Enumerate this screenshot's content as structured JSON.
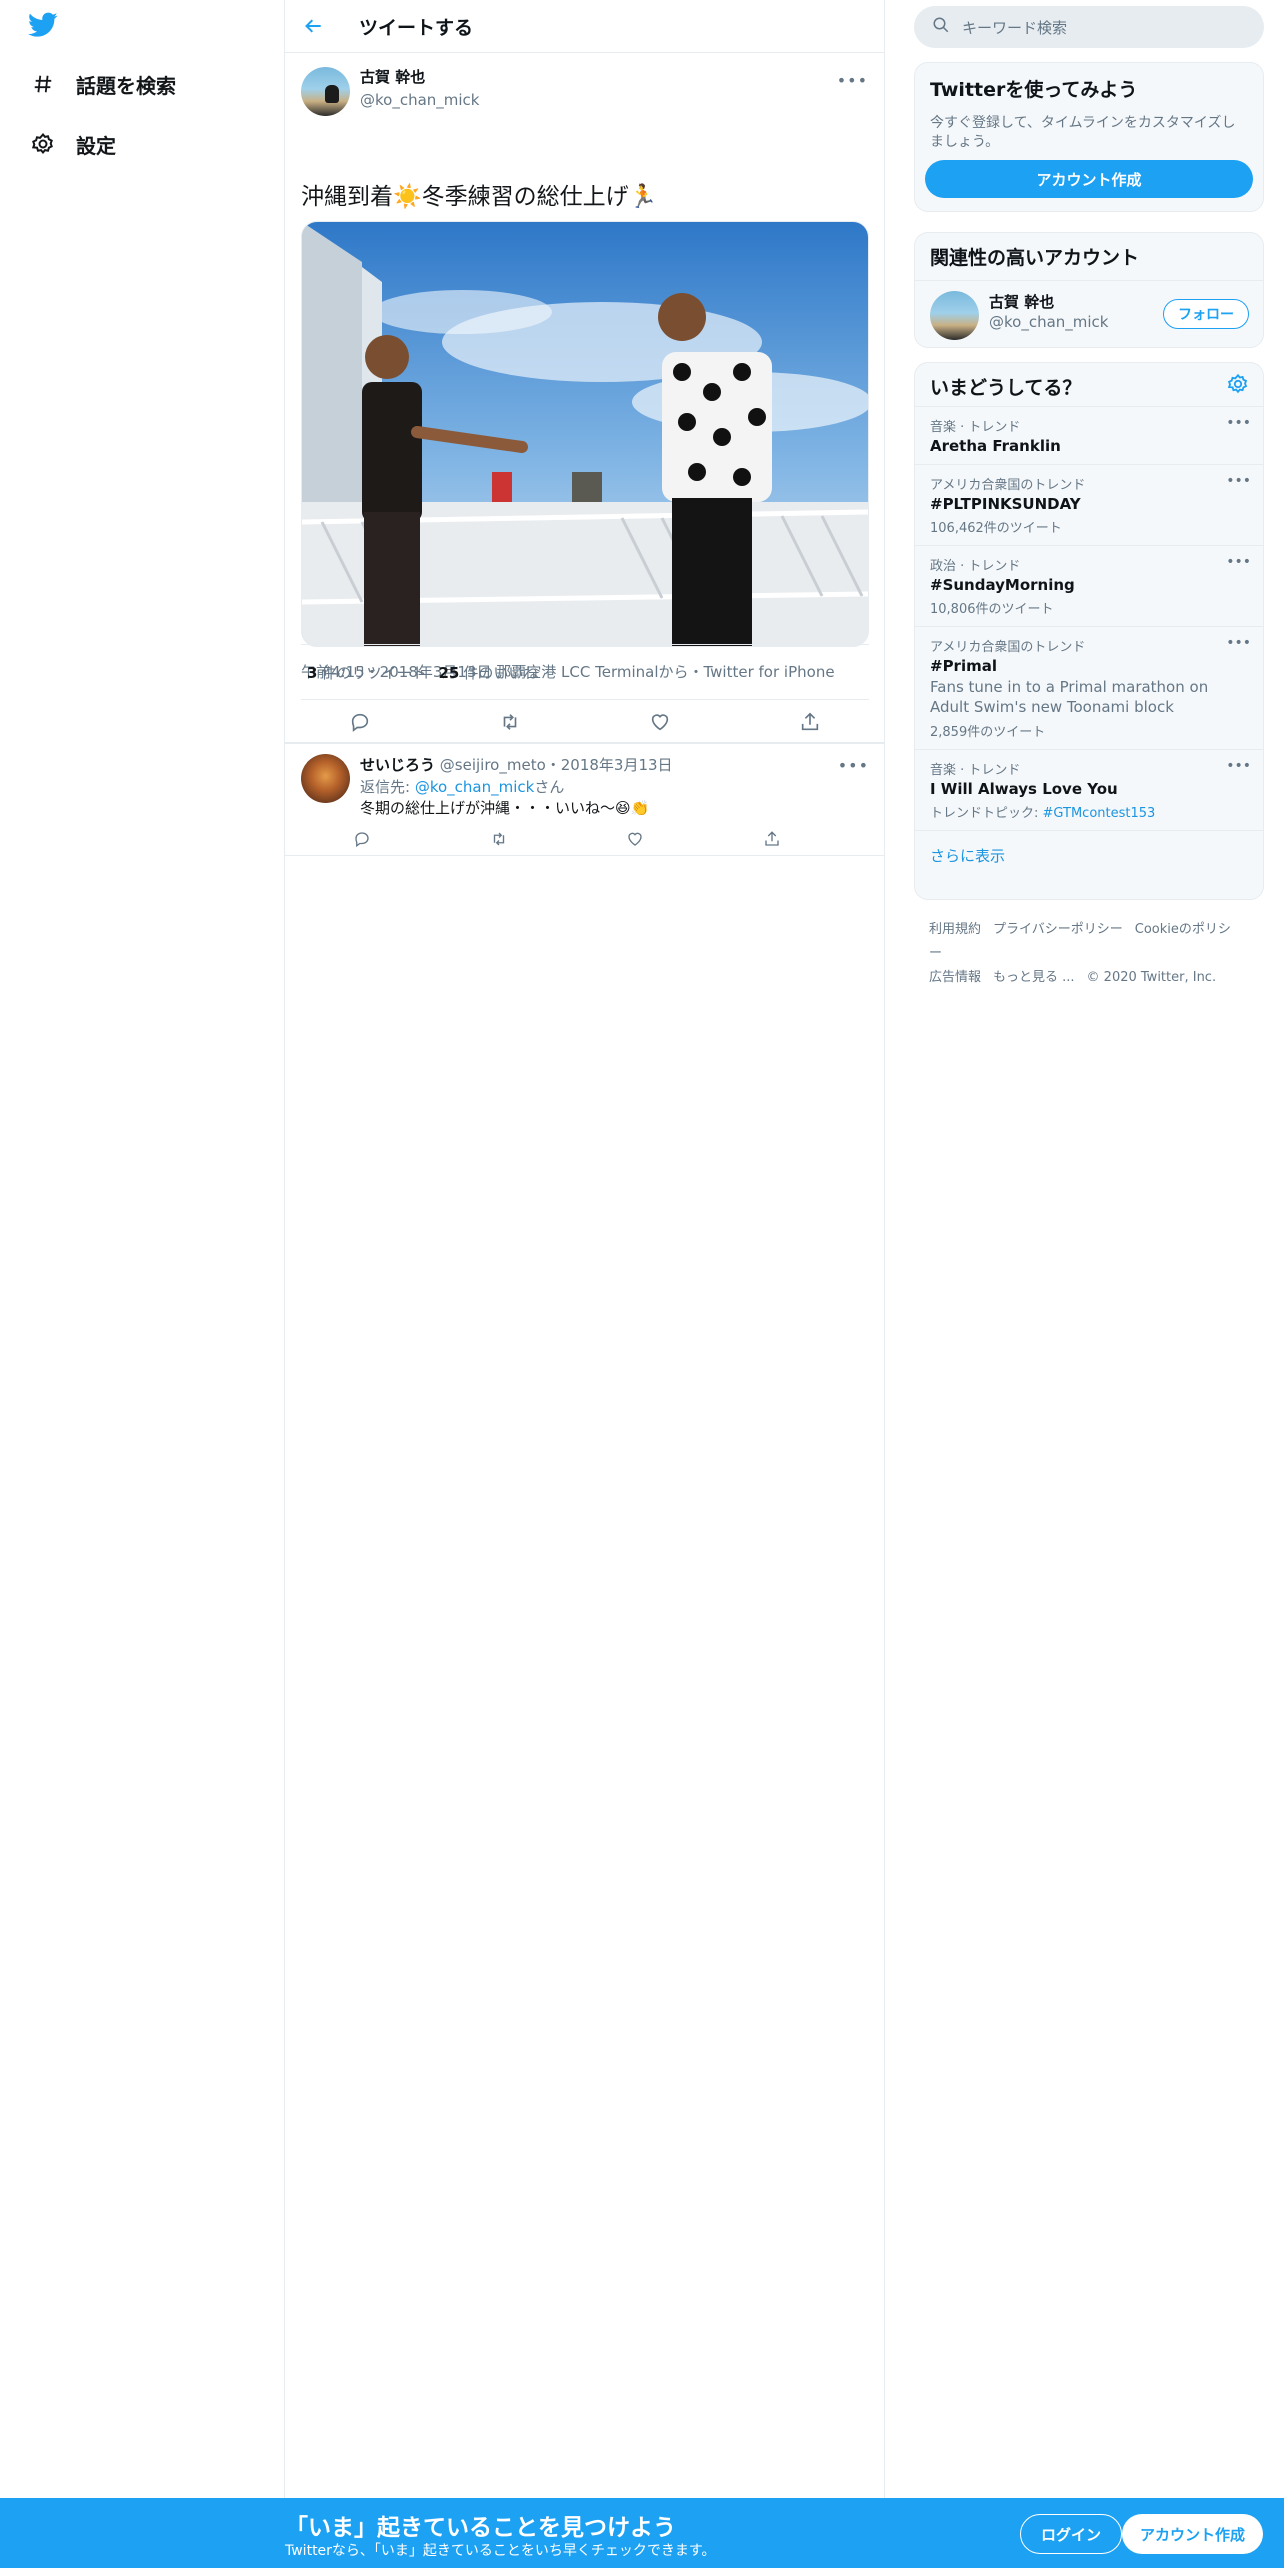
{
  "nav": {
    "explore_label": "話題を検索",
    "settings_label": "設定"
  },
  "header": {
    "title": "ツイートする"
  },
  "tweet": {
    "author_name": "古賀 幹也",
    "author_handle": "@ko_chan_mick",
    "more": "•••",
    "text": "沖縄到着☀️冬季練習の総仕上げ🏃",
    "meta": "午前4:15・2018年3月13日 那覇空港 LCC Terminalから・Twitter for iPhone",
    "retweet_count": "3",
    "retweet_label": "件のリツイート",
    "like_count": "25",
    "like_label": "件のいいね"
  },
  "reply": {
    "name": "せいじろう",
    "meta": "@seijiro_meto・2018年3月13日",
    "to_prefix": "返信先: ",
    "to_handle": "@ko_chan_mick",
    "to_suffix": "さん",
    "text": "冬期の総仕上げが沖縄・・・いいね～😆👏",
    "more": "•••"
  },
  "sidebar": {
    "search_placeholder": "キーワード検索",
    "join_title": "Twitterを使ってみよう",
    "join_desc": "今すぐ登録して、タイムラインをカスタマイズしましょう。",
    "join_button": "アカウント作成",
    "related_title": "関連性の高いアカウント",
    "related_name": "古賀 幹也",
    "related_handle": "@ko_chan_mick",
    "follow_button": "フォロー",
    "trends_title": "いまどうしてる？",
    "trends": [
      {
        "context": "音楽 · トレンド",
        "name": "Aretha Franklin",
        "desc": "",
        "count": "",
        "topic_prefix": "",
        "topic_link": ""
      },
      {
        "context": "アメリカ合衆国のトレンド",
        "name": "#PLTPINKSUNDAY",
        "desc": "",
        "count": "106,462件のツイート",
        "topic_prefix": "",
        "topic_link": ""
      },
      {
        "context": "政治 · トレンド",
        "name": "#SundayMorning",
        "desc": "",
        "count": "10,806件のツイート",
        "topic_prefix": "",
        "topic_link": ""
      },
      {
        "context": "アメリカ合衆国のトレンド",
        "name": "#Primal",
        "desc": "Fans tune in to a Primal marathon on Adult Swim's new Toonami block",
        "count": "2,859件のツイート",
        "topic_prefix": "",
        "topic_link": ""
      },
      {
        "context": "音楽 · トレンド",
        "name": "I Will Always Love You",
        "desc": "",
        "count": "",
        "topic_prefix": "トレンドトピック: ",
        "topic_link": "#GTMcontest153"
      }
    ],
    "show_more": "さらに表示",
    "footer": {
      "terms": "利用規約",
      "privacy": "プライバシーポリシー",
      "cookie": "Cookieのポリシー",
      "ads": "広告情報",
      "more": "もっと見る ...",
      "copyright": "© 2020 Twitter, Inc."
    }
  },
  "banner": {
    "title": "「いま」起きていることを見つけよう",
    "subtitle": "Twitterなら、「いま」起きていることをいち早くチェックできます。",
    "login": "ログイン",
    "signup": "アカウント作成"
  },
  "colors": {
    "accent": "#1da1f2",
    "link": "#1b95e0",
    "muted": "#657786"
  }
}
